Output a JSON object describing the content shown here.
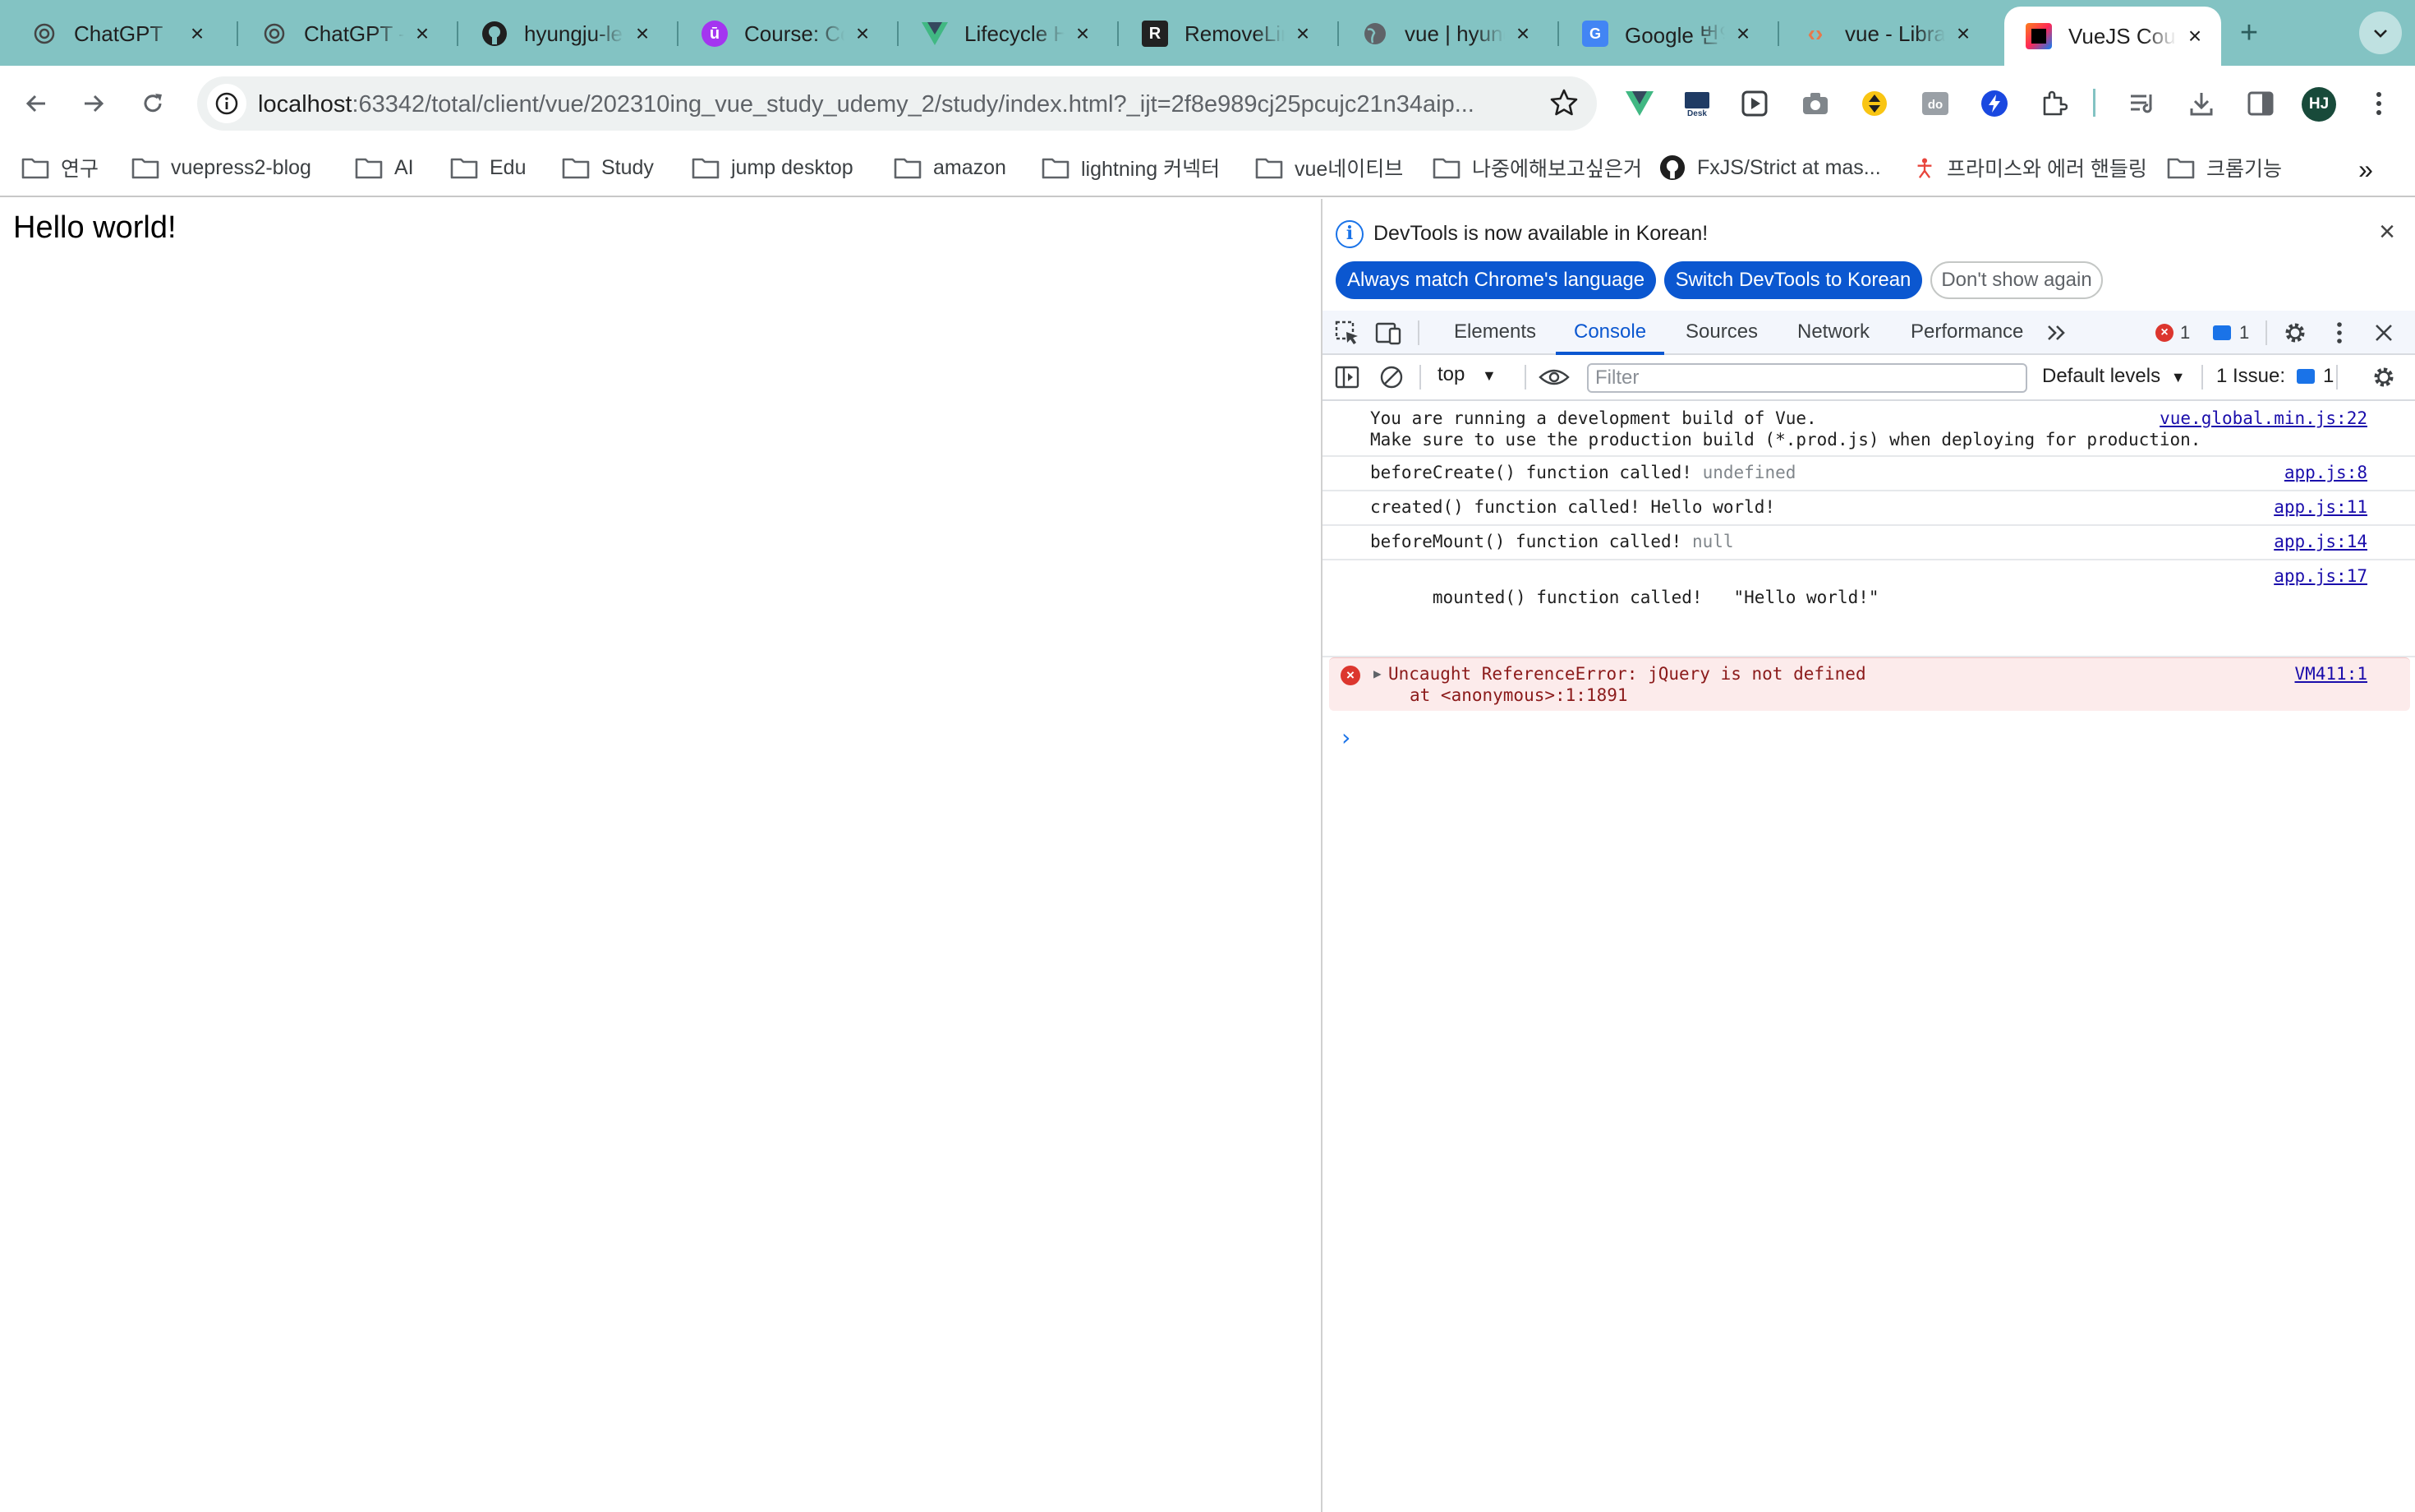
{
  "browser": {
    "tabs": [
      {
        "title": "ChatGPT",
        "icon": "chatgpt-icon",
        "active": false
      },
      {
        "title": "ChatGPT - ",
        "icon": "chatgpt-icon",
        "active": false
      },
      {
        "title": "hyungju-le",
        "icon": "github-icon",
        "active": false
      },
      {
        "title": "Course: Co",
        "icon": "udemy-icon",
        "active": false
      },
      {
        "title": "Lifecycle H",
        "icon": "vue-icon",
        "active": false
      },
      {
        "title": "RemoveLin",
        "icon": "r-icon",
        "active": false
      },
      {
        "title": "vue | hyung",
        "icon": "globe-icon",
        "active": false
      },
      {
        "title": "Google 번역",
        "icon": "google-translate-icon",
        "active": false
      },
      {
        "title": "vue - Libra",
        "icon": "code-icon",
        "active": false
      },
      {
        "title": "VueJS Cou",
        "icon": "jetbrains-icon",
        "active": true
      }
    ],
    "url": {
      "host": "localhost",
      "path": ":63342/total/client/vue/202310ing_vue_study_udemy_2/study/index.html?_ijt=2f8e989cj25pcujc21n34aip..."
    },
    "profile_initials": "HJ",
    "bookmarks": [
      {
        "label": "연구",
        "icon": "folder-icon"
      },
      {
        "label": "vuepress2-blog",
        "icon": "folder-icon"
      },
      {
        "label": "AI",
        "icon": "folder-icon"
      },
      {
        "label": "Edu",
        "icon": "folder-icon"
      },
      {
        "label": "Study",
        "icon": "folder-icon"
      },
      {
        "label": "jump desktop",
        "icon": "folder-icon"
      },
      {
        "label": "amazon",
        "icon": "folder-icon"
      },
      {
        "label": "lightning 커넥터",
        "icon": "folder-icon"
      },
      {
        "label": "vue네이티브",
        "icon": "folder-icon"
      },
      {
        "label": "나중에해보고싶은거",
        "icon": "folder-icon"
      },
      {
        "label": "FxJS/Strict at mas...",
        "icon": "github-icon"
      },
      {
        "label": "프라미스와 에러 핸들링",
        "icon": "person-icon"
      },
      {
        "label": "크롬기능",
        "icon": "folder-icon"
      }
    ],
    "more_bookmarks": "»"
  },
  "page": {
    "heading": "Hello world!"
  },
  "devtools": {
    "infobar": {
      "message": "DevTools is now available in Korean!",
      "btn_match": "Always match Chrome's language",
      "btn_switch": "Switch DevTools to Korean",
      "btn_dismiss": "Don't show again"
    },
    "tabs": [
      "Elements",
      "Console",
      "Sources",
      "Network",
      "Performance"
    ],
    "active_tab": "Console",
    "error_count": "1",
    "message_count": "1",
    "context": "top",
    "filter_placeholder": "Filter",
    "levels": "Default levels",
    "issues_label": "1 Issue:",
    "issues_count": "1",
    "logs": [
      {
        "text": "You are running a development build of Vue.",
        "text2": "Make sure to use the production build (*.prod.js) when deploying for production.",
        "source": "vue.global.min.js:22"
      },
      {
        "text": "beforeCreate() function called!",
        "extra": "undefined",
        "source": "app.js:8"
      },
      {
        "text": "created() function called! Hello world!",
        "source": "app.js:11"
      },
      {
        "text": "beforeMount() function called!",
        "extra": "null",
        "source": "app.js:14"
      },
      {
        "text": "mounted() function called!   \"Hello world!\"",
        "source": "app.js:17"
      }
    ],
    "error": {
      "text": "Uncaught ReferenceError: jQuery is not defined",
      "stack": "at <anonymous>:1:1891",
      "source": "VM411:1"
    },
    "prompt": "›"
  },
  "colors": {
    "tabstrip": "#83c3c3",
    "accent": "#0b57d0",
    "error_bg": "#fcebeb",
    "error_icon": "#dc362e"
  }
}
